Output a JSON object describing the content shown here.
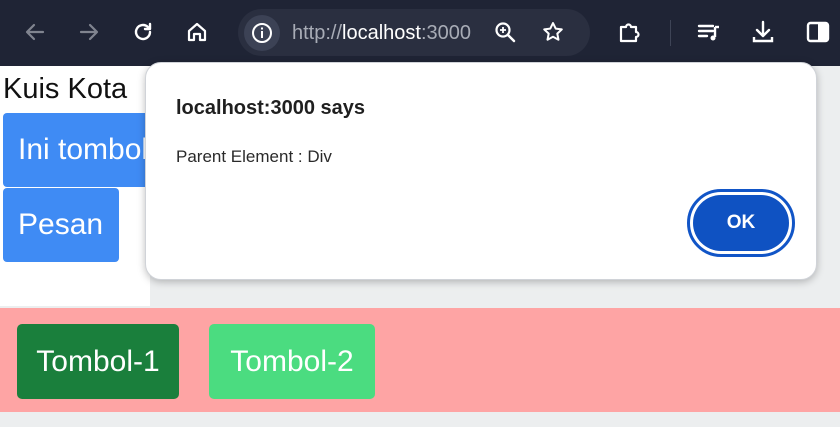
{
  "browser": {
    "url_scheme": "http://",
    "url_host": "localhost",
    "url_port": ":3000"
  },
  "page": {
    "heading": "Kuis Kota",
    "button_one_label": "Ini tombol",
    "button_pesan_label": "Pesan",
    "tombol1_label": "Tombol-1",
    "tombol2_label": "Tombol-2"
  },
  "dialog": {
    "title": "localhost:3000 says",
    "message": "Parent Element : Div",
    "ok_label": "OK"
  },
  "colors": {
    "toolbar_bg": "#1f2435",
    "button_blue": "#3f8bf4",
    "band_pink": "#fea4a4",
    "tombol1_green": "#1a7f3c",
    "tombol2_green": "#4bdc80",
    "ok_blue": "#0f52c2"
  }
}
